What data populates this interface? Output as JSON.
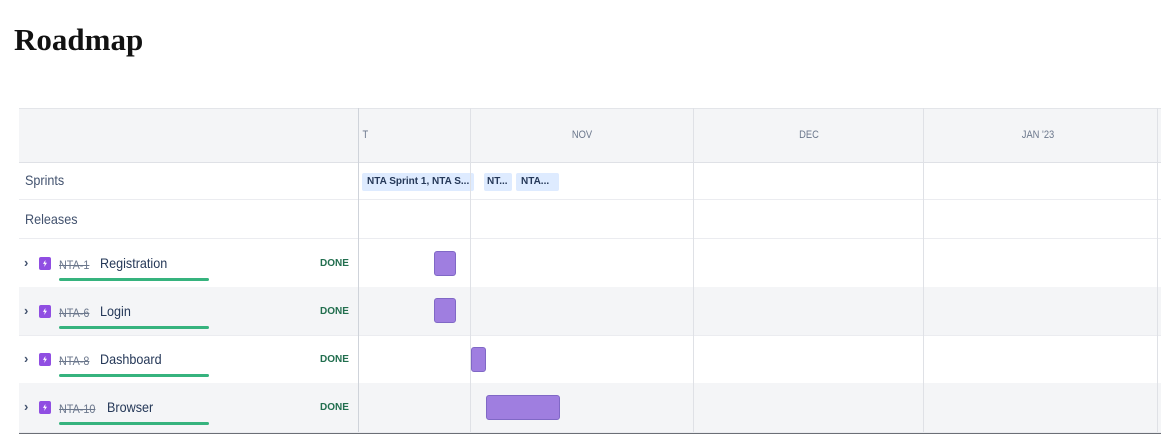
{
  "page_title": "Roadmap",
  "timeline": {
    "months": [
      "T",
      "NOV",
      "DEC",
      "JAN '23"
    ]
  },
  "rows": {
    "sprints_label": "Sprints",
    "releases_label": "Releases",
    "sprints": [
      "NTA Sprint 1, NTA S...",
      "NT...",
      "NTA..."
    ]
  },
  "epics": [
    {
      "key": "NTA-1",
      "summary": "Registration",
      "status": "DONE",
      "progress": 1.0
    },
    {
      "key": "NTA-6",
      "summary": "Login",
      "status": "DONE",
      "progress": 1.0
    },
    {
      "key": "NTA-8",
      "summary": "Dashboard",
      "status": "DONE",
      "progress": 1.0
    },
    {
      "key": "NTA-10",
      "summary": "Browser",
      "status": "DONE",
      "progress": 1.0
    }
  ],
  "colors": {
    "epic_bar": "#9f7ee0",
    "epic_icon": "#904ee2",
    "progress": "#36b37e",
    "status_done": "#216e4e",
    "sprint_chip": "#deebff"
  }
}
